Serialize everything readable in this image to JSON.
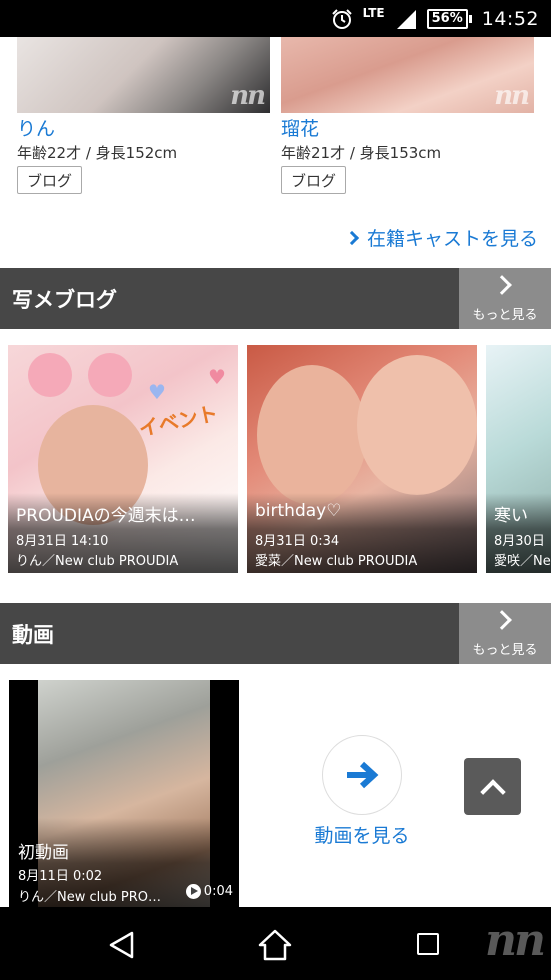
{
  "status_bar": {
    "network": "LTE",
    "battery": "56%",
    "time": "14:52",
    "icons": [
      "alarm-icon",
      "signal-icon",
      "battery-icon"
    ]
  },
  "cast": [
    {
      "name": "りん",
      "info": "年齢22才 / 身長152cm",
      "blog_label": "ブログ",
      "watermark": "nn"
    },
    {
      "name": "瑠花",
      "info": "年齢21才 / 身長153cm",
      "blog_label": "ブログ",
      "watermark": "nn"
    }
  ],
  "see_all_cast": "在籍キャストを見る",
  "blog_section": {
    "title": "写メブログ",
    "more_label": "もっと見る",
    "cards": [
      {
        "title": "PROUDIAの今週末は…",
        "date": "8月31日 14:10",
        "author": "りん／New club PROUDIA",
        "decoration": "イベント"
      },
      {
        "title": "birthday♡",
        "date": "8月31日 0:34",
        "author": "愛菜／New club PROUDIA"
      },
      {
        "title": "寒い",
        "date": "8月30日",
        "author": "愛咲／New club PROUDIA"
      }
    ]
  },
  "video_section": {
    "title": "動画",
    "more_label": "もっと見る",
    "video": {
      "title": "初動画",
      "date": "8月11日 0:02",
      "author": "りん／New club PRO…",
      "duration": "0:04"
    },
    "see_video_label": "動画を見る"
  },
  "nav": {
    "watermark": "nn",
    "icons": [
      "back-icon",
      "home-icon",
      "recent-apps-icon"
    ]
  },
  "colors": {
    "link": "#1a7ad4",
    "header_bg": "#474747",
    "more_bg": "#8c8c8c",
    "scroll_top_bg": "#5a5a5a"
  }
}
